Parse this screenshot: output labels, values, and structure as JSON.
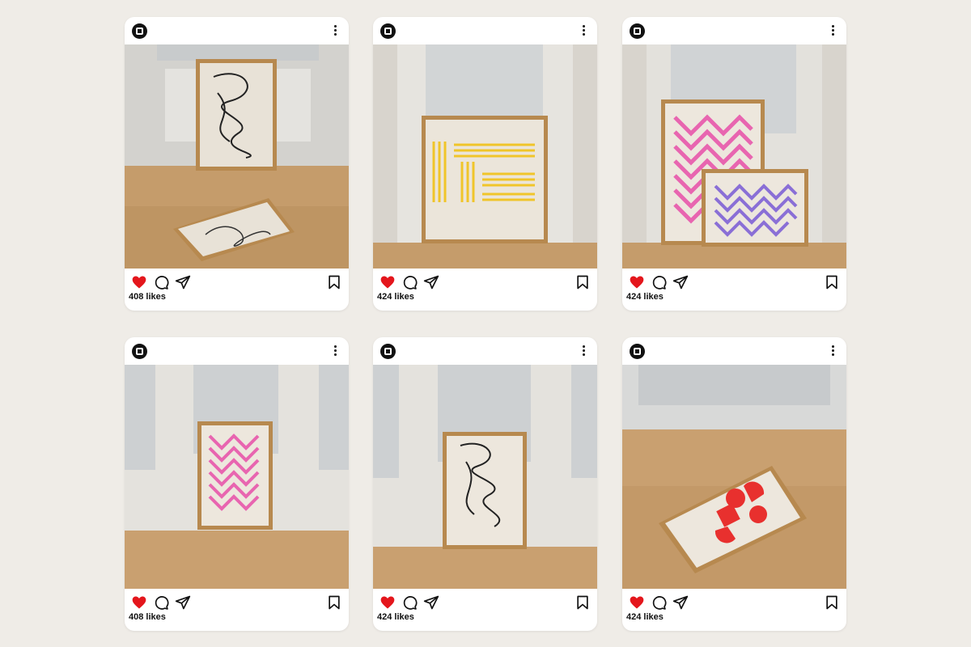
{
  "colors": {
    "background": "#efece7",
    "heart": "#e4161c",
    "card": "#ffffff"
  },
  "icons": {
    "avatar": "circle-logo-icon",
    "more": "more-vertical-icon",
    "like": "heart-filled-icon",
    "comment": "comment-bubble-icon",
    "share": "paper-plane-icon",
    "save": "bookmark-icon"
  },
  "posts": [
    {
      "likes_text": "408 likes",
      "artwork": "black squiggle line art poster"
    },
    {
      "likes_text": "424 likes",
      "artwork": "yellow striped pattern poster"
    },
    {
      "likes_text": "424 likes",
      "artwork": "pink and purple zigzag posters"
    },
    {
      "likes_text": "408 likes",
      "artwork": "pink zigzag poster"
    },
    {
      "likes_text": "424 likes",
      "artwork": "black squiggle line art poster"
    },
    {
      "likes_text": "424 likes",
      "artwork": "red geometric shapes poster"
    }
  ]
}
